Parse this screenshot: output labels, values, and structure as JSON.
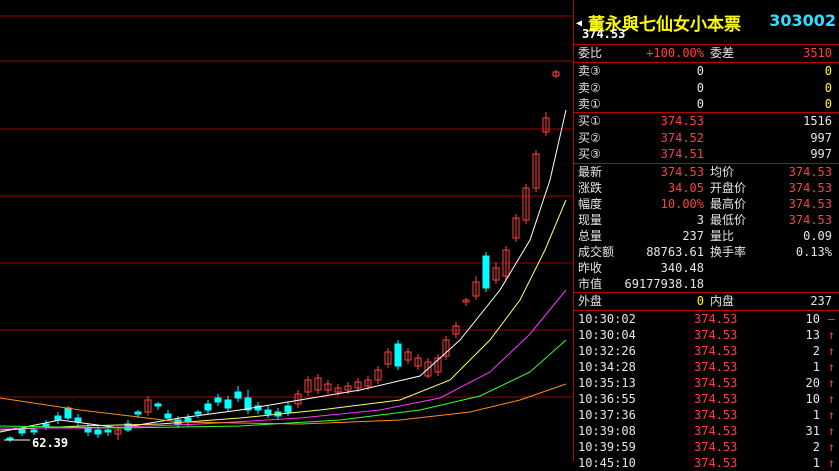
{
  "chart": {
    "high_label": "374.53",
    "low_label": "62.39"
  },
  "header": {
    "stock_name": "董永與七仙女小本票",
    "stock_code": "303002"
  },
  "order_book": {
    "weibi_label": "委比",
    "weibi_value": "+100.00%",
    "weicha_label": "委差",
    "weicha_value": "3510",
    "sells": [
      {
        "label": "卖③",
        "price": "0",
        "vol": "0"
      },
      {
        "label": "卖②",
        "price": "0",
        "vol": "0"
      },
      {
        "label": "卖①",
        "price": "0",
        "vol": "0"
      }
    ],
    "buys": [
      {
        "label": "买①",
        "price": "374.53",
        "vol": "1516"
      },
      {
        "label": "买②",
        "price": "374.52",
        "vol": "997"
      },
      {
        "label": "买③",
        "price": "374.51",
        "vol": "997"
      }
    ]
  },
  "quote": [
    {
      "l1": "最新",
      "v1": "374.53",
      "l2": "均价",
      "v2": "374.53"
    },
    {
      "l1": "涨跌",
      "v1": "34.05",
      "l2": "开盘价",
      "v2": "374.53"
    },
    {
      "l1": "幅度",
      "v1": "10.00%",
      "l2": "最高价",
      "v2": "374.53"
    },
    {
      "l1": "现量",
      "v1": "3",
      "l2": "最低价",
      "v2": "374.53"
    },
    {
      "l1": "总量",
      "v1": "237",
      "l2": "量比",
      "v2": "0.09"
    },
    {
      "l1": "成交额",
      "v1": "88763.61",
      "l2": "换手率",
      "v2": "0.13%"
    },
    {
      "l1": "昨收",
      "v1": "340.48",
      "l2": "",
      "v2": ""
    },
    {
      "l1": "市值",
      "v1": "69177938.18",
      "l2": "",
      "v2": ""
    }
  ],
  "flow": {
    "outer_label": "外盘",
    "outer_value": "0",
    "inner_label": "内盘",
    "inner_value": "237"
  },
  "ticks": [
    {
      "time": "10:30:02",
      "price": "374.53",
      "vol": "10",
      "dir": "—"
    },
    {
      "time": "10:30:04",
      "price": "374.53",
      "vol": "13",
      "dir": "↑"
    },
    {
      "time": "10:32:26",
      "price": "374.53",
      "vol": "2",
      "dir": "↑"
    },
    {
      "time": "10:34:28",
      "price": "374.53",
      "vol": "1",
      "dir": "↑"
    },
    {
      "time": "10:35:13",
      "price": "374.53",
      "vol": "20",
      "dir": "↑"
    },
    {
      "time": "10:36:55",
      "price": "374.53",
      "vol": "10",
      "dir": "↑"
    },
    {
      "time": "10:37:36",
      "price": "374.53",
      "vol": "1",
      "dir": "↑"
    },
    {
      "time": "10:39:08",
      "price": "374.53",
      "vol": "31",
      "dir": "↑"
    },
    {
      "time": "10:39:59",
      "price": "374.53",
      "vol": "2",
      "dir": "↑"
    },
    {
      "time": "10:45:10",
      "price": "374.53",
      "vol": "1",
      "dir": "↑"
    }
  ]
}
